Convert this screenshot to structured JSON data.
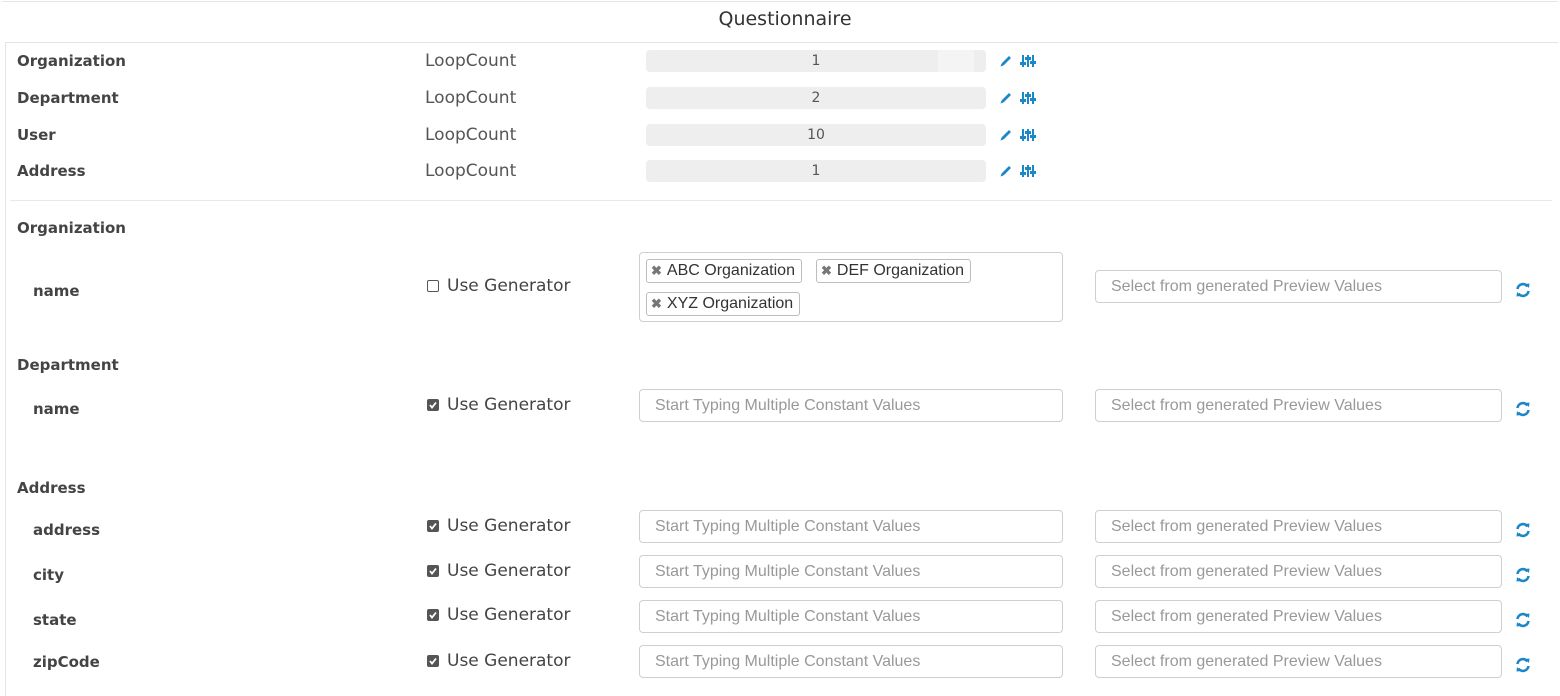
{
  "title": "Questionnaire",
  "loops": [
    {
      "entity": "Organization",
      "label": "LoopCount",
      "value": "1"
    },
    {
      "entity": "Department",
      "label": "LoopCount",
      "value": "2"
    },
    {
      "entity": "User",
      "label": "LoopCount",
      "value": "10"
    },
    {
      "entity": "Address",
      "label": "LoopCount",
      "value": "1"
    }
  ],
  "sections": {
    "organization": {
      "header": "Organization",
      "fields": [
        {
          "name": "name",
          "use_generator": false,
          "generator_label": "Use Generator",
          "tags": [
            "ABC Organization",
            "DEF Organization",
            "XYZ Organization"
          ],
          "preview_placeholder": "Select from generated Preview Values"
        }
      ]
    },
    "department": {
      "header": "Department",
      "fields": [
        {
          "name": "name",
          "use_generator": true,
          "generator_label": "Use Generator",
          "constant_placeholder": "Start Typing Multiple Constant Values",
          "preview_placeholder": "Select from generated Preview Values"
        }
      ]
    },
    "address": {
      "header": "Address",
      "fields": [
        {
          "name": "address",
          "use_generator": true,
          "generator_label": "Use Generator",
          "constant_placeholder": "Start Typing Multiple Constant Values",
          "preview_placeholder": "Select from generated Preview Values"
        },
        {
          "name": "city",
          "use_generator": true,
          "generator_label": "Use Generator",
          "constant_placeholder": "Start Typing Multiple Constant Values",
          "preview_placeholder": "Select from generated Preview Values"
        },
        {
          "name": "state",
          "use_generator": true,
          "generator_label": "Use Generator",
          "constant_placeholder": "Start Typing Multiple Constant Values",
          "preview_placeholder": "Select from generated Preview Values"
        },
        {
          "name": "zipCode",
          "use_generator": true,
          "generator_label": "Use Generator",
          "constant_placeholder": "Start Typing Multiple Constant Values",
          "preview_placeholder": "Select from generated Preview Values"
        }
      ]
    }
  },
  "icons": {
    "edit": "pencil-icon",
    "settings": "sliders-icon",
    "refresh": "refresh-icon",
    "remove": "remove-tag-icon"
  },
  "colors": {
    "accent": "#1a87c9",
    "checkbox": "#555555",
    "input_disabled_bg": "#eeeeee"
  }
}
